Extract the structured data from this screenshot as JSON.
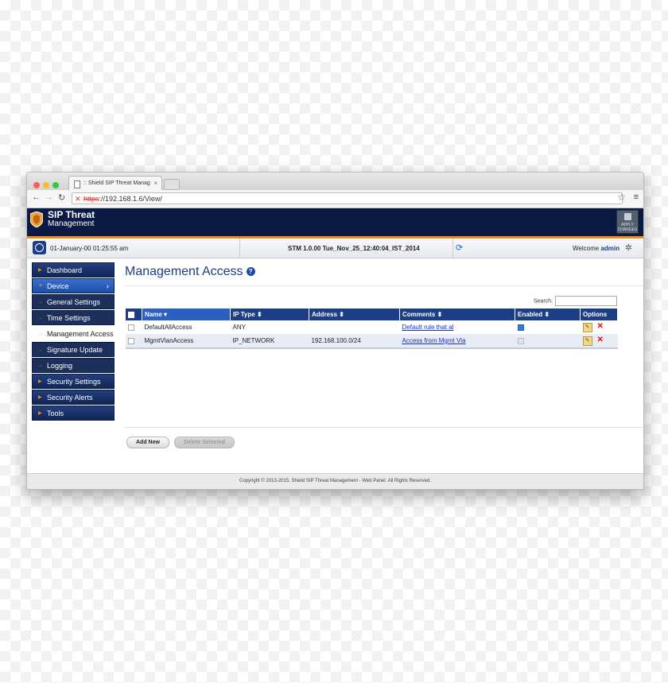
{
  "browser": {
    "tab_title": ":: Shield SIP Threat Manag",
    "url_scheme": "https",
    "url_rest": "://192.168.1.6/View/"
  },
  "header": {
    "brand_line1": "SIP Threat",
    "brand_line2": "Management",
    "apply_label": "APPLY CHANGES"
  },
  "statusbar": {
    "datetime": "01-January-00  01:25:55 am",
    "version": "STM 1.0.00 Tue_Nov_25_12:40:04_IST_2014",
    "welcome": "Welcome",
    "user": "admin"
  },
  "sidebar": {
    "dashboard": "Dashboard",
    "device": "Device",
    "general_settings": "General Settings",
    "time_settings": "Time Settings",
    "management_access": "Management Access",
    "signature_update": "Signature Update",
    "logging": "Logging",
    "security_settings": "Security Settings",
    "security_alerts": "Security Alerts",
    "tools": "Tools"
  },
  "page": {
    "title": "Management Access",
    "search_label": "Search:"
  },
  "table": {
    "columns": {
      "name": "Name",
      "ip_type": "IP Type",
      "address": "Address",
      "comments": "Comments",
      "enabled": "Enabled",
      "options": "Options"
    },
    "rows": [
      {
        "name": "DefaultAllAccess",
        "ip_type": "ANY",
        "address": "",
        "comments": "Default rule that al",
        "enabled": true
      },
      {
        "name": "MgmtVlanAccess",
        "ip_type": "IP_NETWORK",
        "address": "192.168.100.0/24",
        "comments": "Access from Mgmt Vla",
        "enabled": true
      }
    ]
  },
  "buttons": {
    "add_new": "Add New",
    "delete_selected": "Delete Selected"
  },
  "footer": {
    "text": "Copyright © 2013-2015. Shield SIP Threat Management - Web Panel. All Rights Reserved."
  },
  "colors": {
    "header_bg": "#0b1a44",
    "accent_orange": "#f28a16",
    "nav_blue": "#1c3e86"
  }
}
